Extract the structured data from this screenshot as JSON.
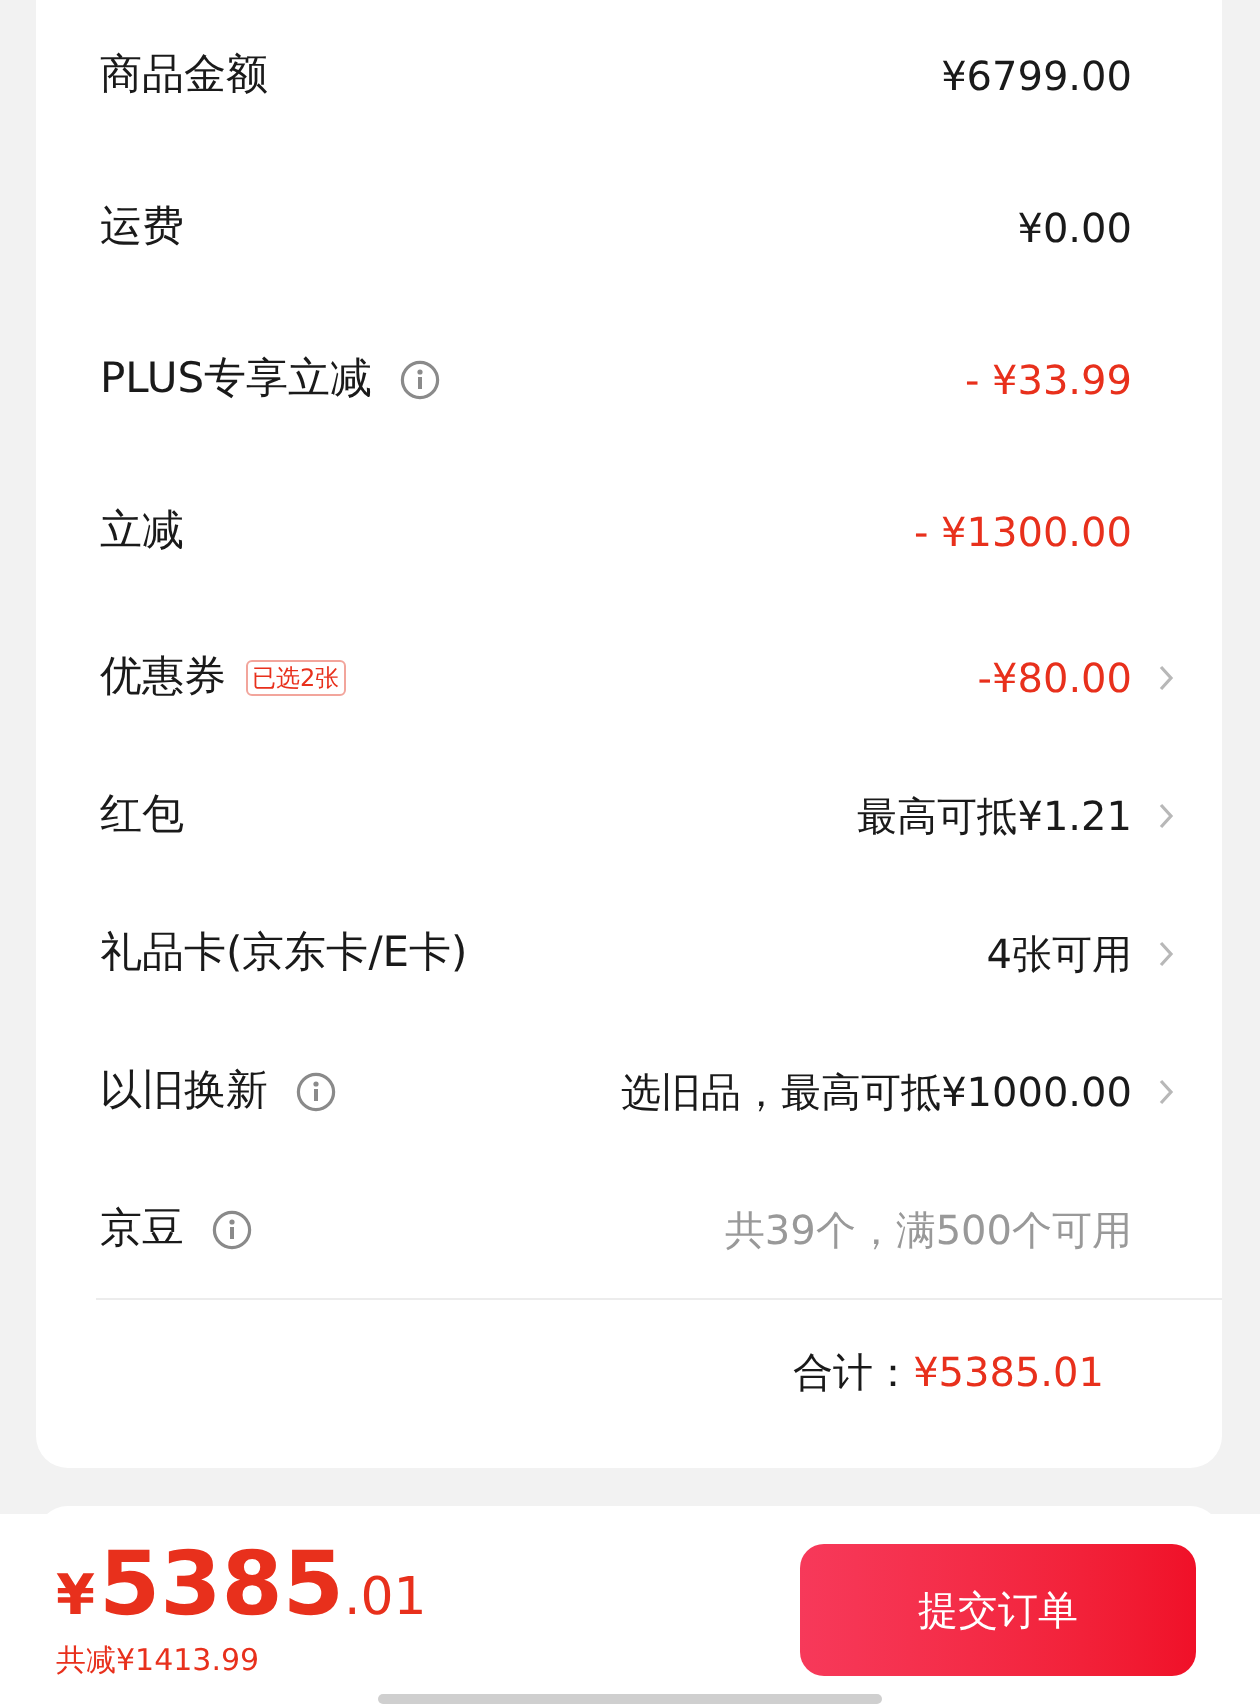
{
  "summary": {
    "rows": [
      {
        "label": "商品金额",
        "info": false,
        "value": "¥6799.00",
        "kind": "amount",
        "chevron": false
      },
      {
        "label": "运费",
        "info": false,
        "value": "¥0.00",
        "kind": "amount",
        "chevron": false
      },
      {
        "label": "PLUS专享立减",
        "info": true,
        "value": "- ¥33.99",
        "kind": "discount",
        "chevron": false
      },
      {
        "label": "立减",
        "info": false,
        "value": "- ¥1300.00",
        "kind": "discount",
        "chevron": false
      },
      {
        "label": "优惠券",
        "info": false,
        "tag": "已选2张",
        "value": "-¥80.00",
        "kind": "discount",
        "chevron": true
      },
      {
        "label": "红包",
        "info": false,
        "value": "最高可抵¥1.21",
        "kind": "amount",
        "chevron": true
      },
      {
        "label": "礼品卡(京东卡/E卡)",
        "info": false,
        "value": "4张可用",
        "kind": "amount",
        "chevron": true
      },
      {
        "label": "以旧换新",
        "info": true,
        "value": "选旧品，最高可抵¥1000.00",
        "kind": "amount",
        "chevron": true
      },
      {
        "label": "京豆",
        "info": true,
        "value": "共39个，满500个可用",
        "kind": "hint",
        "chevron": false
      }
    ],
    "total_label": "合计：",
    "total_value": "¥5385.01"
  },
  "footer": {
    "currency": "¥",
    "integer": "5385",
    "decimal": ".01",
    "saved": "共减¥1413.99",
    "submit": "提交订单"
  }
}
